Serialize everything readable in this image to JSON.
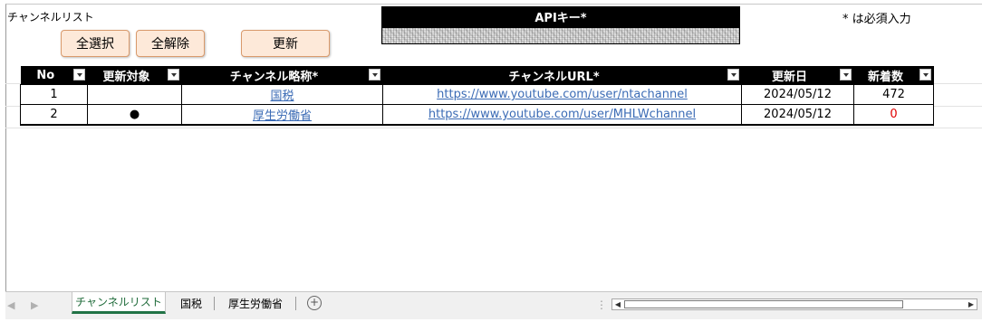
{
  "sheet_title": "チャンネルリスト",
  "buttons": {
    "select_all": "全選択",
    "deselect_all": "全解除",
    "update": "更新"
  },
  "api": {
    "header": "APIキー*"
  },
  "required_note": "* は必須入力",
  "table": {
    "headers": [
      "No",
      "更新対象",
      "チャンネル略称*",
      "チャンネルURL*",
      "更新日",
      "新着数"
    ],
    "rows": [
      {
        "no": "1",
        "target": "",
        "name": "国税",
        "url": "https://www.youtube.com/user/ntachannel",
        "date": "2024/05/12",
        "new_count": "472"
      },
      {
        "no": "2",
        "target": "●",
        "name": "厚生労働省",
        "url": "https://www.youtube.com/user/MHLWchannel",
        "date": "2024/05/12",
        "new_count": "0"
      }
    ]
  },
  "tabs": [
    "チャンネルリスト",
    "国税",
    "厚生労働省"
  ],
  "colors": {
    "header_bg": "#000000",
    "button_bg": "#fde9d9",
    "link": "#3b6bb5",
    "zero_count": "#e00000",
    "active_tab": "#217346"
  }
}
